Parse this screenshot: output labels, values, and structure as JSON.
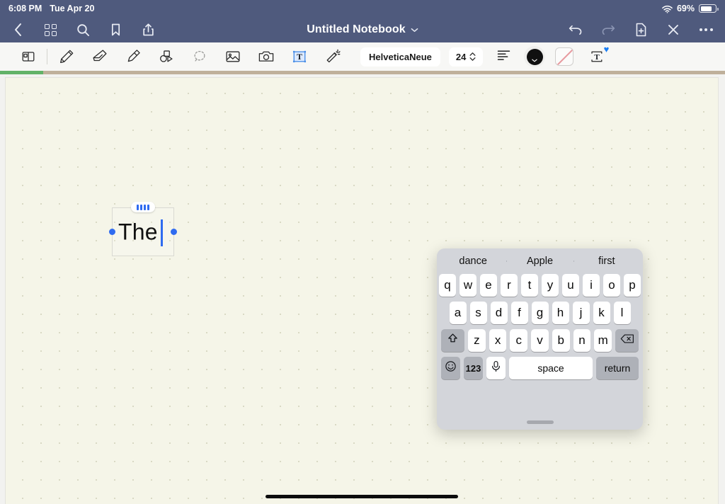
{
  "status_bar": {
    "time": "6:08 PM",
    "date": "Tue Apr 20",
    "wifi_icon": "wifi-icon",
    "battery_percent": "69%",
    "battery_level": 69
  },
  "nav_bar": {
    "title": "Untitled Notebook",
    "title_chevron_icon": "chevron-down-icon",
    "left_items": [
      {
        "name": "back-button",
        "icon": "chevron-left-icon"
      },
      {
        "name": "pages-grid-button",
        "icon": "grid-icon"
      },
      {
        "name": "search-button",
        "icon": "search-icon"
      },
      {
        "name": "bookmark-button",
        "icon": "bookmark-icon"
      },
      {
        "name": "share-button",
        "icon": "share-icon"
      }
    ],
    "right_items": [
      {
        "name": "undo-button",
        "icon": "undo-icon",
        "enabled": true
      },
      {
        "name": "redo-button",
        "icon": "redo-icon",
        "enabled": false
      },
      {
        "name": "add-page-button",
        "icon": "document-plus-icon",
        "enabled": true
      },
      {
        "name": "close-button",
        "icon": "close-icon",
        "enabled": true
      },
      {
        "name": "more-button",
        "icon": "ellipsis-icon",
        "enabled": true
      }
    ]
  },
  "toolbar": {
    "tools": [
      {
        "name": "page-split-tool",
        "icon": "page-split-icon",
        "selected": false
      },
      {
        "name": "pen-tool",
        "icon": "pen-icon",
        "selected": false
      },
      {
        "name": "eraser-tool",
        "icon": "eraser-icon",
        "selected": false
      },
      {
        "name": "highlighter-tool",
        "icon": "highlighter-icon",
        "selected": false
      },
      {
        "name": "shapes-tool",
        "icon": "shapes-icon",
        "selected": false
      },
      {
        "name": "lasso-tool",
        "icon": "lasso-icon",
        "selected": false
      },
      {
        "name": "image-tool",
        "icon": "image-icon",
        "selected": false
      },
      {
        "name": "camera-tool",
        "icon": "camera-icon",
        "selected": false
      },
      {
        "name": "text-tool",
        "icon": "text-box-icon",
        "selected": true
      },
      {
        "name": "magic-wand-tool",
        "icon": "magic-wand-icon",
        "selected": false
      }
    ],
    "font_family": "HelveticaNeue",
    "font_size": "24",
    "align_icon": "align-left-icon",
    "text_color": "#101010",
    "fill": "none",
    "favorite_badge_icon": "heart-icon",
    "favorite_badge_color": "#1a7ef5"
  },
  "progress": {
    "percent": 6,
    "track_color": "#bfb09b",
    "fill_color": "#62b268"
  },
  "canvas": {
    "paper_color": "#f5f5e8",
    "dot_color": "#d9d9c4",
    "textbox": {
      "text": "The",
      "caret_color": "#2f6bf0",
      "handle_color": "#2f6bf0",
      "drag_handle_icon": "drag-handle-icon"
    }
  },
  "keyboard": {
    "predictions": [
      "dance",
      "Apple",
      "first"
    ],
    "row1": [
      "q",
      "w",
      "e",
      "r",
      "t",
      "y",
      "u",
      "i",
      "o",
      "p"
    ],
    "row2": [
      "a",
      "s",
      "d",
      "f",
      "g",
      "h",
      "j",
      "k",
      "l"
    ],
    "row3_letters": [
      "z",
      "x",
      "c",
      "v",
      "b",
      "n",
      "m"
    ],
    "shift_icon": "shift-icon",
    "backspace_icon": "backspace-icon",
    "emoji_icon": "emoji-icon",
    "numbers_label": "123",
    "mic_icon": "microphone-icon",
    "space_label": "space",
    "return_label": "return",
    "drag_handle_icon": "keyboard-drag-handle-icon"
  },
  "home_indicator": "home-indicator"
}
